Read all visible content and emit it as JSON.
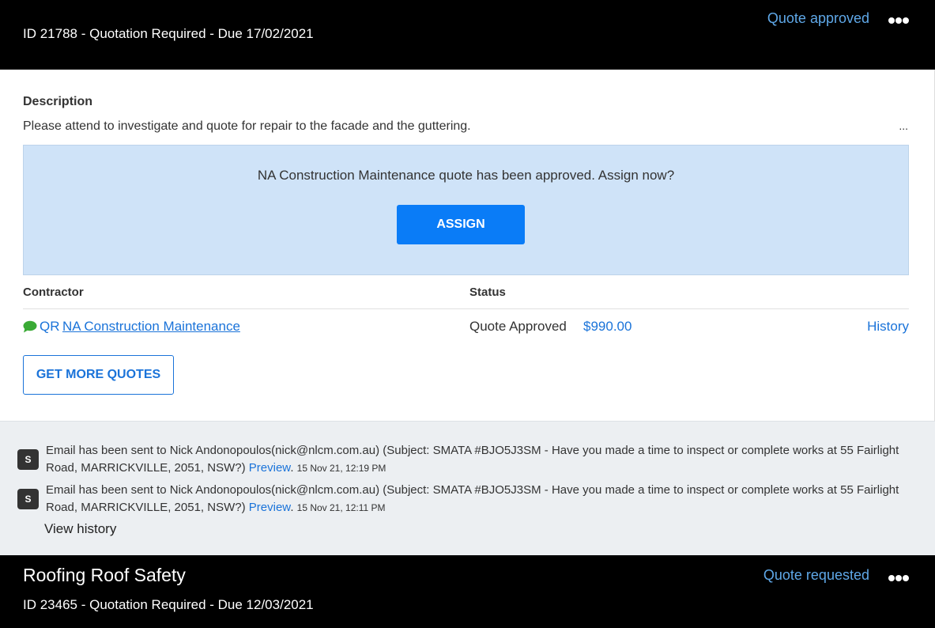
{
  "job1": {
    "id_line": "ID 21788 - Quotation Required - Due 17/02/2021",
    "status": "Quote approved",
    "description_label": "Description",
    "description_text": "Please attend to investigate and quote for repair to the facade and the guttering.",
    "description_more": "...",
    "alert": {
      "text": "NA Construction Maintenance quote has been approved. Assign now?",
      "button_label": "ASSIGN"
    },
    "table": {
      "headers": {
        "contractor": "Contractor",
        "status": "Status"
      },
      "rows": [
        {
          "code": "QR",
          "contractor": "NA Construction Maintenance",
          "status": "Quote Approved",
          "amount": "$990.00",
          "history": "History"
        }
      ]
    },
    "get_more_quotes_label": "GET MORE QUOTES",
    "activity": [
      {
        "avatar": "S",
        "text": "Email has been sent to Nick Andonopoulos(nick@nlcm.com.au) (Subject: SMATA #BJO5J3SM - Have you made a time to inspect or complete works at 55 Fairlight Road, MARRICKVILLE, 2051, NSW?)",
        "preview": "Preview",
        "time": "15 Nov 21, 12:19 PM"
      },
      {
        "avatar": "S",
        "text": "Email has been sent to Nick Andonopoulos(nick@nlcm.com.au) (Subject: SMATA #BJO5J3SM - Have you made a time to inspect or complete works at 55 Fairlight Road, MARRICKVILLE, 2051, NSW?)",
        "preview": "Preview",
        "time": "15 Nov 21, 12:11 PM"
      }
    ],
    "view_history_label": "View history"
  },
  "job2": {
    "title": "Roofing Roof Safety",
    "id_line": "ID 23465 - Quotation Required - Due 12/03/2021",
    "status": "Quote requested"
  },
  "colors": {
    "header_bg": "#000000",
    "status_link": "#5fa8e8",
    "link": "#1a73d9",
    "assign_button": "#0a7cf7",
    "alert_bg": "#cfe3f8",
    "activity_bg": "#eceff2",
    "chat_icon": "#3aaa35"
  },
  "icons": {
    "menu": "more-dots-icon",
    "chat": "chat-bubble-icon",
    "avatar": "user-avatar-icon"
  }
}
